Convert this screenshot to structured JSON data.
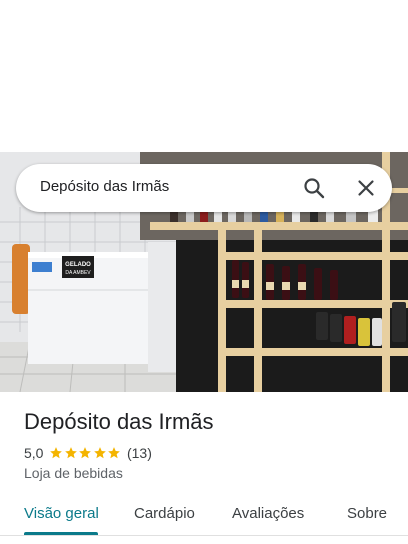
{
  "search": {
    "query": "Depósito das Irmãs",
    "search_icon": "search-icon",
    "close_icon": "close-icon"
  },
  "place": {
    "name": "Depósito das Irmãs",
    "rating": "5,0",
    "stars": 5,
    "review_count": "(13)",
    "category": "Loja de bebidas"
  },
  "photo": {
    "counter_sign_text": [
      "GELADO",
      "DA AMBEV"
    ]
  },
  "tabs": [
    {
      "label": "Visão geral",
      "active": true
    },
    {
      "label": "Cardápio",
      "active": false
    },
    {
      "label": "Avaliações",
      "active": false
    },
    {
      "label": "Sobre",
      "active": false
    }
  ],
  "colors": {
    "accent": "#0b7a8a",
    "star": "#f4b400"
  }
}
